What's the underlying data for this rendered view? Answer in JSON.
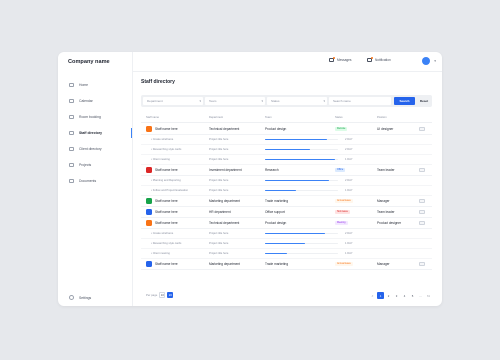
{
  "company": "Company name",
  "nav": [
    {
      "label": "Home",
      "icon": "home-icon"
    },
    {
      "label": "Calendar",
      "icon": "calendar-icon"
    },
    {
      "label": "Room booking",
      "icon": "room-icon"
    },
    {
      "label": "Staff directory",
      "icon": "staff-icon",
      "active": true
    },
    {
      "label": "Client directory",
      "icon": "client-icon"
    },
    {
      "label": "Projects",
      "icon": "projects-icon"
    },
    {
      "label": "Documents",
      "icon": "documents-icon"
    }
  ],
  "settings": "Settings",
  "topbar": {
    "messages": "Messages",
    "notification": "Notification"
  },
  "page_title": "Staff directory",
  "filters": {
    "department": "Department",
    "team": "Team",
    "status": "Status",
    "search_placeholder": "Search name",
    "search_button": "Search",
    "reset": "Reset"
  },
  "columns": {
    "staff": "Staff name",
    "department": "Department",
    "team": "Team",
    "status": "Status",
    "position": "Position"
  },
  "colors": {
    "accent": "#2563eb",
    "green": "#16a34a",
    "orange": "#f97316",
    "red": "#dc2626",
    "purple": "#9333ea"
  },
  "rows": [
    {
      "name": "Staff name here",
      "department": "Technical department",
      "team": "Product design",
      "status": "Remote",
      "position": "UI designer",
      "avatar": "#f97316",
      "status_bg": "#dcfce7",
      "status_color": "#16a34a",
      "tasks": [
        {
          "name": "Create wireframe",
          "dept": "Project title here",
          "progress": 0.85,
          "date": "2 DAY"
        },
        {
          "name": "Researching style cards",
          "dept": "Project title here",
          "progress": 0.62,
          "date": "2 DAY"
        },
        {
          "name": "Client meeting",
          "dept": "Project title here",
          "progress": 0.96,
          "date": "1 DAY"
        }
      ]
    },
    {
      "name": "Staff name here",
      "department": "Investment department",
      "team": "Research",
      "status": "Office",
      "position": "Team leader",
      "avatar": "#dc2626",
      "status_bg": "#dbeafe",
      "status_color": "#2563eb",
      "tasks": [
        {
          "name": "Planning and Reporting",
          "dept": "Project title here",
          "progress": 0.88,
          "date": "2 DAY"
        },
        {
          "name": "Follow and Project Evaluation",
          "dept": "Project title here",
          "progress": 0.42,
          "date": "1 DAY"
        }
      ]
    },
    {
      "name": "Staff name here",
      "department": "Marketing department",
      "team": "Trade marketing",
      "status": "Annual leave",
      "position": "Manager",
      "avatar": "#16a34a",
      "status_bg": "#fff7ed",
      "status_color": "#f97316",
      "tasks": []
    },
    {
      "name": "Staff name here",
      "department": "HR department",
      "team": "Office support",
      "status": "Sick leave",
      "position": "Team leader",
      "avatar": "#2563eb",
      "status_bg": "#fee2e2",
      "status_color": "#dc2626",
      "tasks": []
    },
    {
      "name": "Staff name here",
      "department": "Technical department",
      "team": "Product design",
      "status": "Meeting",
      "position": "Product designer",
      "avatar": "#f97316",
      "status_bg": "#f3e8ff",
      "status_color": "#9333ea",
      "tasks": [
        {
          "name": "Create wireframe",
          "dept": "Project title here",
          "progress": 0.82,
          "date": "2 DAY"
        },
        {
          "name": "Researching style cards",
          "dept": "Project title here",
          "progress": 0.55,
          "date": "1 DAY"
        },
        {
          "name": "Client meeting",
          "dept": "Project title here",
          "progress": 0.3,
          "date": "1 DAY"
        }
      ]
    },
    {
      "name": "Staff name here",
      "department": "Marketing department",
      "team": "Trade marketing",
      "status": "Annual leave",
      "position": "Manager",
      "avatar": "#2563eb",
      "status_bg": "#fff7ed",
      "status_color": "#f97316",
      "tasks": []
    }
  ],
  "pagination": {
    "per_page_label": "Per page",
    "per_page_options": [
      "10",
      "20"
    ],
    "per_page_active": "20",
    "pages": [
      "<",
      "1",
      "2",
      "3",
      "4",
      "5",
      "...",
      ">>"
    ],
    "current": "1"
  }
}
